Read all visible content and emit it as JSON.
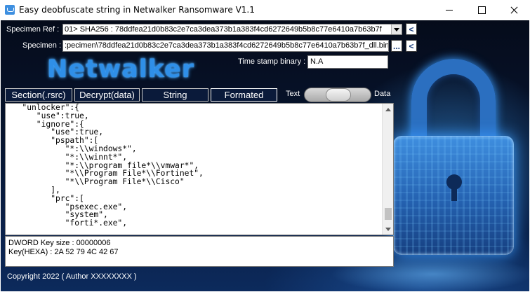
{
  "window": {
    "title": "Easy deobfuscate string in Netwalker Ransomware V1.1",
    "app_icon": "app-icon",
    "controls": [
      "minimize-icon",
      "maximize-icon",
      "close-icon"
    ]
  },
  "specimen_ref": {
    "label": "Specimen Ref :",
    "value": "01> SHA256 : 78ddfea21d0b83c2e7ca3dea373b1a383f4cd6272649b5b8c77e6410a7b63b7f",
    "back_button": "<"
  },
  "specimen": {
    "label": "Specimen :",
    "value": ":pecimen\\78ddfea21d0b83c2e7ca3dea373b1a383f4cd6272649b5b8c77e6410a7b63b7f_dll.bin",
    "browse_button": "...",
    "back_button": "<"
  },
  "brand": "Netwalker",
  "timestamp": {
    "label": "Time stamp binary :",
    "value": "N.A"
  },
  "tabs": [
    {
      "label": "Section(.rsrc)"
    },
    {
      "label": "Decrypt(data)"
    },
    {
      "label": "String"
    },
    {
      "label": "Formated"
    }
  ],
  "toggle": {
    "left_label": "Text",
    "right_label": "Data"
  },
  "code_lines": [
    "   \"unlocker\":{",
    "      \"use\":true,",
    "      \"ignore\":{",
    "         \"use\":true,",
    "         \"pspath\":[",
    "            \"*:\\\\windows*\",",
    "            \"*:\\\\winnt*\",",
    "            \"*:\\\\program file*\\\\vmwar*\",",
    "            \"*\\\\Program File*\\\\Fortinet\",",
    "            \"*\\\\Program File*\\\\Cisco\"",
    "         ],",
    "         \"prc\":[",
    "            \"psexec.exe\",",
    "            \"system\",",
    "            \"forti*.exe\","
  ],
  "info": {
    "dword_line": "DWORD Key size : 00000006",
    "key_line": "Key(HEXA) :  2A 52 79 4C 42 67"
  },
  "copyright": "Copyright 2022 ( Author XXXXXXXX )",
  "colors": {
    "brand_blue": "#2f8fe8",
    "background_dark": "#071530",
    "tab_background": "#0a1a3a"
  }
}
